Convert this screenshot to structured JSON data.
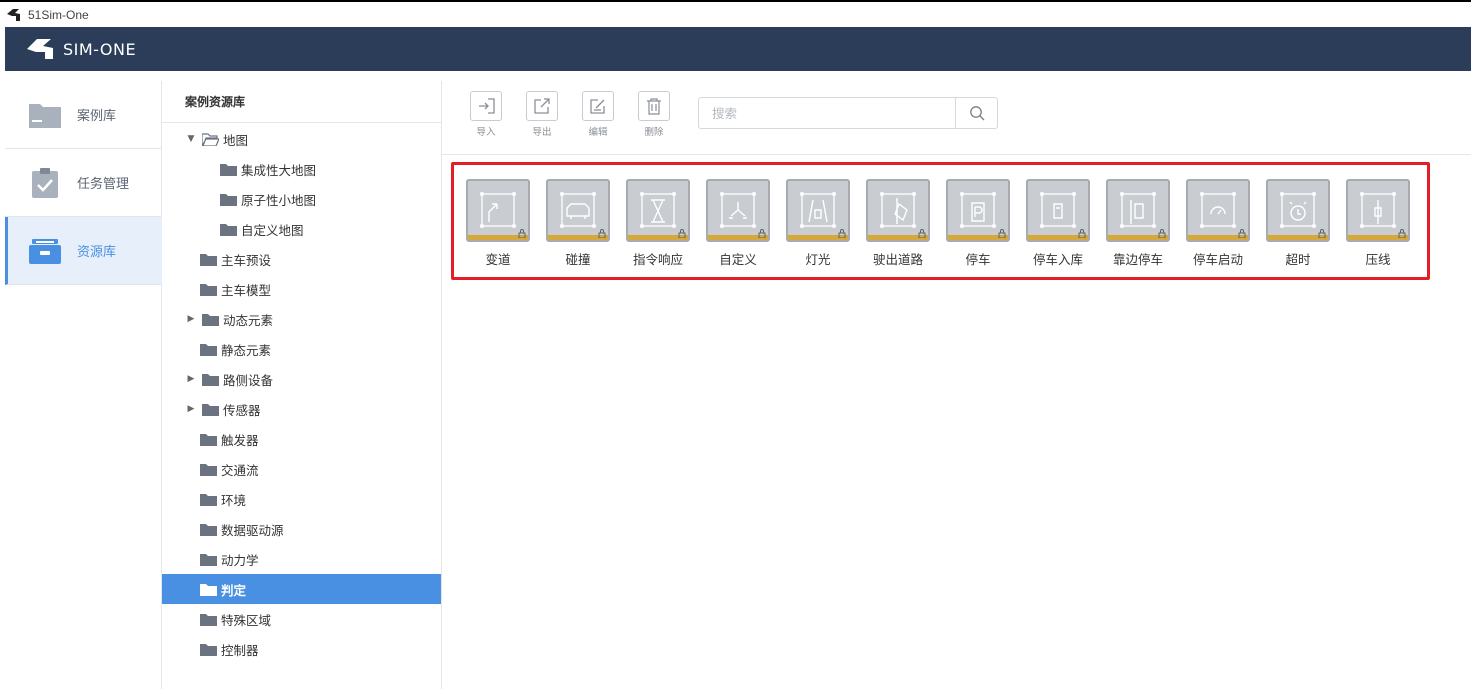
{
  "titlebar": {
    "title": "51Sim-One"
  },
  "header": {
    "brand": "SIM-ONE"
  },
  "nav": [
    {
      "label": "案例库",
      "icon": "folder-icon"
    },
    {
      "label": "任务管理",
      "icon": "clipboard-check-icon"
    },
    {
      "label": "资源库",
      "icon": "toolbox-icon",
      "active": true
    }
  ],
  "tree": {
    "title": "案例资源库",
    "items": [
      {
        "label": "地图",
        "expanded": true
      },
      {
        "label": "集成性大地图"
      },
      {
        "label": "原子性小地图"
      },
      {
        "label": "自定义地图"
      },
      {
        "label": "主车预设"
      },
      {
        "label": "主车模型"
      },
      {
        "label": "动态元素",
        "collapsed": true
      },
      {
        "label": "静态元素"
      },
      {
        "label": "路侧设备",
        "collapsed": true
      },
      {
        "label": "传感器",
        "collapsed": true
      },
      {
        "label": "触发器"
      },
      {
        "label": "交通流"
      },
      {
        "label": "环境"
      },
      {
        "label": "数据驱动源"
      },
      {
        "label": "动力学"
      },
      {
        "label": "判定",
        "selected": true
      },
      {
        "label": "特殊区域"
      },
      {
        "label": "控制器"
      }
    ]
  },
  "toolbar": {
    "import_label": "导入",
    "export_label": "导出",
    "edit_label": "编辑",
    "delete_label": "删除",
    "search_placeholder": "搜索"
  },
  "cards": [
    {
      "label": "变道",
      "icon": "lane-change-icon"
    },
    {
      "label": "碰撞",
      "icon": "collision-icon"
    },
    {
      "label": "指令响应",
      "icon": "hourglass-icon"
    },
    {
      "label": "自定义",
      "icon": "custom-flow-icon"
    },
    {
      "label": "灯光",
      "icon": "car-lights-icon"
    },
    {
      "label": "驶出道路",
      "icon": "off-road-icon"
    },
    {
      "label": "停车",
      "icon": "parking-icon"
    },
    {
      "label": "停车入库",
      "icon": "park-in-icon"
    },
    {
      "label": "靠边停车",
      "icon": "pull-over-icon"
    },
    {
      "label": "停车启动",
      "icon": "start-gauge-icon"
    },
    {
      "label": "超时",
      "icon": "alarm-clock-icon"
    },
    {
      "label": "压线",
      "icon": "line-pressing-icon"
    }
  ],
  "colors": {
    "header_bg": "#2b3d59",
    "accent": "#4a90e2",
    "highlight_border": "#e41e26",
    "card_bar": "#d6a73a"
  }
}
